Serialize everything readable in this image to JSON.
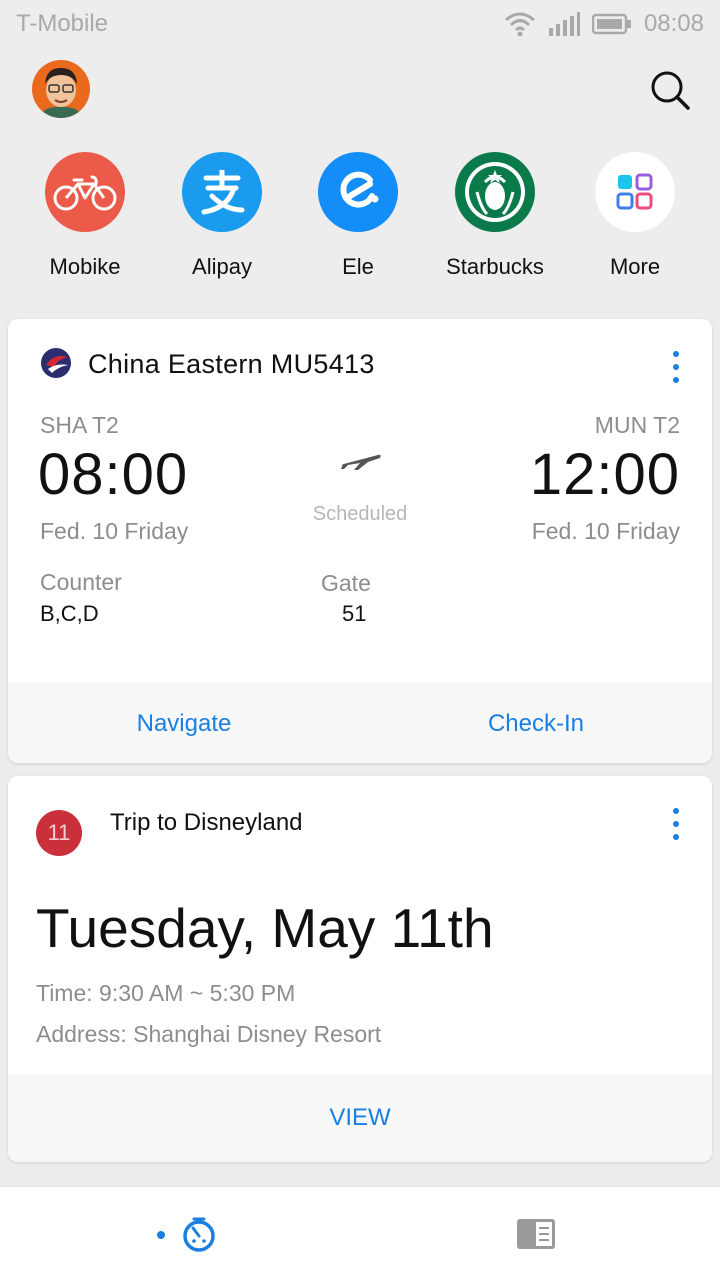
{
  "status_bar": {
    "carrier": "T-Mobile",
    "time": "08:08",
    "icons": [
      "wifi-icon",
      "signal-icon",
      "battery-icon"
    ]
  },
  "header": {
    "avatar": "avatar",
    "search_icon": "search-icon"
  },
  "apps": [
    {
      "label": "Mobike",
      "icon": "bike-icon",
      "color": "#ec5a49"
    },
    {
      "label": "Alipay",
      "icon": "alipay-icon",
      "color": "#1a9bee"
    },
    {
      "label": "Ele",
      "icon": "ele-icon",
      "color": "#138df7"
    },
    {
      "label": "Starbucks",
      "icon": "starbucks-icon",
      "color": "#0a7a4a"
    },
    {
      "label": "More",
      "icon": "grid-icon",
      "color": "#ffffff"
    }
  ],
  "flight_card": {
    "title": "China Eastern MU5413",
    "origin": {
      "code": "SHA T2",
      "time": "08:00",
      "date": "Fed. 10  Friday"
    },
    "destination": {
      "code": "MUN T2",
      "time": "12:00",
      "date": "Fed. 10  Friday"
    },
    "status": "Scheduled",
    "counter_label": "Counter",
    "counter_value": "B,C,D",
    "gate_label": "Gate",
    "gate_value": "51",
    "navigate_label": "Navigate",
    "checkin_label": "Check-In"
  },
  "trip_card": {
    "badge": "11",
    "title": "Trip to Disneyland",
    "date": "Tuesday, May 11th",
    "time": "Time: 9:30 AM ~ 5:30 PM",
    "address": "Address: Shanghai Disney Resort",
    "view_label": "VIEW"
  },
  "bottom_nav": {
    "items": [
      "timer-icon",
      "reader-icon"
    ],
    "active_index": 0
  },
  "colors": {
    "accent": "#1a7fe0",
    "background": "#ededed"
  }
}
